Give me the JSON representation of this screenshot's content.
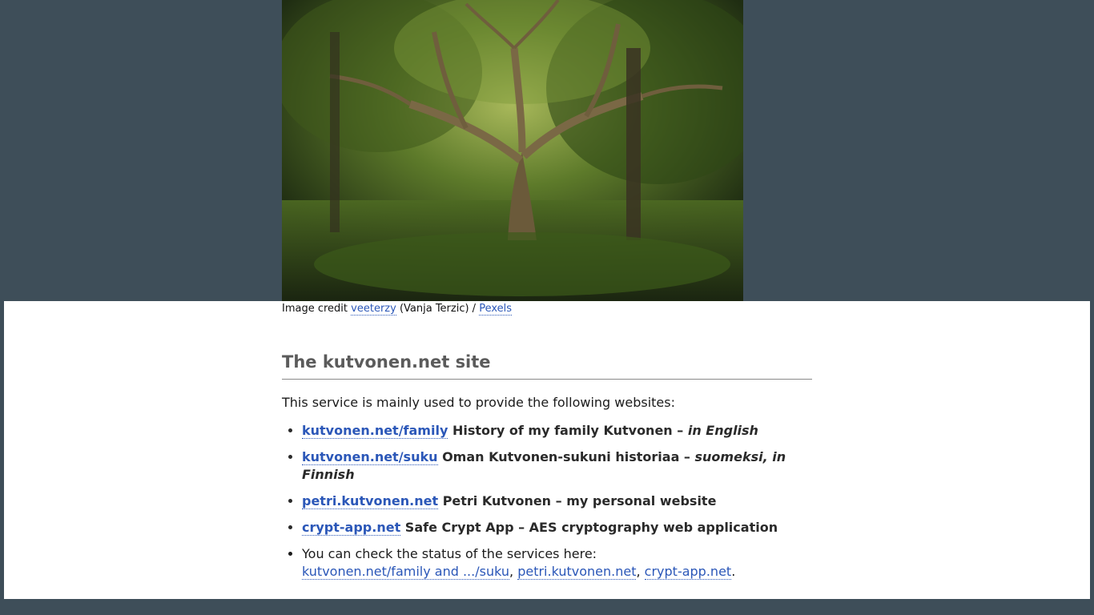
{
  "hero": {
    "alt": "Forest with a large old tree"
  },
  "credit": {
    "prefix": "Image credit",
    "author_link": "veeterzy",
    "author_name": "(Vanja Terzic) /",
    "source_link": "Pexels"
  },
  "title": "The kutvonen.net site",
  "intro": "This service is mainly used to provide the following websites:",
  "sites": [
    {
      "link": "kutvonen.net/family",
      "desc": "History of my family Kutvonen –",
      "lang": "in English"
    },
    {
      "link": "kutvonen.net/suku",
      "desc": "Oman Kutvonen-sukuni historiaa –",
      "lang": "suomeksi, in Finnish"
    },
    {
      "link": "petri.kutvonen.net",
      "desc": "Petri Kutvonen – my personal website",
      "lang": ""
    },
    {
      "link": "crypt-app.net",
      "desc": "Safe Crypt App – AES cryptography web application",
      "lang": ""
    }
  ],
  "status": {
    "text": "You can check the status of the services here:",
    "links": [
      "kutvonen.net/family and .../suku",
      "petri.kutvonen.net",
      "crypt-app.net"
    ],
    "sep": ",",
    "end": "."
  },
  "colors": {
    "page_bg": "#3e4e59",
    "card_bg": "#ffffff",
    "link": "#2b57b8",
    "title": "#5b5b5b"
  }
}
